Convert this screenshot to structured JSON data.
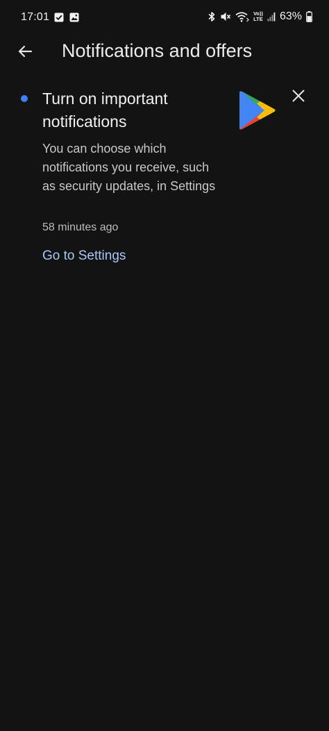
{
  "status_bar": {
    "time": "17:01",
    "battery_percent": "63%",
    "left_icons": [
      "checkbox-notification-icon",
      "gallery-notification-icon"
    ],
    "right_icons": [
      "bluetooth-icon",
      "mute-icon",
      "wifi-calling-icon",
      "volte-icon",
      "signal-icon",
      "battery-icon"
    ],
    "volte_top": "Vo))",
    "volte_bottom": "LTE",
    "battery_level": 0.63
  },
  "header": {
    "title": "Notifications and offers",
    "back_icon": "arrow-back-icon"
  },
  "notification": {
    "title": "Turn on important notifications",
    "body": "You can choose which notifications you receive, such as security updates, in Settings",
    "time": "58 minutes ago",
    "action_label": "Go to Settings",
    "unread": true,
    "app_icon": "google-play-icon",
    "dismiss_icon": "close-icon"
  },
  "colors": {
    "background": "#131313",
    "unread_dot": "#3b82f6",
    "link": "#a8c7fa",
    "play_blue": "#4285F4",
    "play_green": "#34A853",
    "play_yellow": "#FBBC04",
    "play_red": "#EA4335"
  }
}
